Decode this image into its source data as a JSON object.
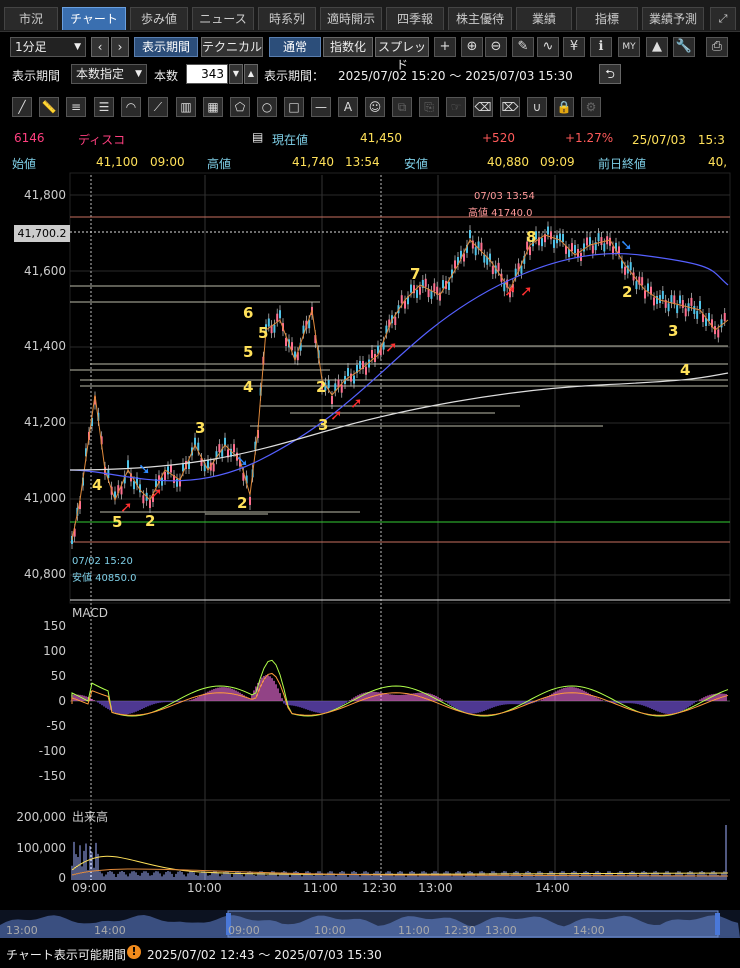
{
  "tabs": [
    "市況",
    "チャート",
    "歩み値",
    "ニュース",
    "時系列",
    "適時開示",
    "四季報",
    "株主優待",
    "業績",
    "指標",
    "業績予測"
  ],
  "active_tab": "チャート",
  "toolbar": {
    "interval": "1分足",
    "period_btn": "表示期間",
    "technical_btn": "テクニカル",
    "normal_btn": "通常",
    "index_btn": "指数化",
    "spread_btn": "スプレッド"
  },
  "period_bar": {
    "label": "表示期間",
    "mode": "本数指定",
    "count_label": "本数",
    "count": "343",
    "range_label": "表示期間：",
    "range": "2025/07/02 15:20 ～ 2025/07/03 15:30"
  },
  "quote": {
    "code": "6146",
    "name": "ディスコ",
    "current_label": "現在値",
    "current": "41,450",
    "change": "+520",
    "change_pct": "+1.27%",
    "datetime": "25/07/03　15:3",
    "open_label": "始値",
    "open": "41,100",
    "open_time": "09:00",
    "high_label": "高値",
    "high": "41,740",
    "high_time": "13:54",
    "low_label": "安値",
    "low": "40,880",
    "low_time": "09:09",
    "prev_label": "前日終値",
    "prev": "40,"
  },
  "price_axis": [
    "41,800",
    "41,700.2",
    "41,600",
    "41,400",
    "41,200",
    "41,000",
    "40,800"
  ],
  "annot": {
    "high_date": "07/03 13:54",
    "high_text": "高値 41740.0",
    "low_date": "07/02 15:20",
    "low_text": "安値 40850.0"
  },
  "macd": {
    "label": "MACD",
    "axis": [
      "150",
      "100",
      "50",
      "0",
      "-50",
      "-100",
      "-150"
    ]
  },
  "volume": {
    "label": "出来高",
    "axis": [
      "200,000",
      "100,000",
      "0"
    ]
  },
  "time_axis": [
    "09:00",
    "10:00",
    "11:00",
    "12:30",
    "13:00",
    "14:00"
  ],
  "nav_axis": [
    "13:00",
    "14:00",
    "09:00",
    "10:00",
    "11:00",
    "12:30",
    "13:00",
    "14:00"
  ],
  "footer": {
    "label": "チャート表示可能期間",
    "range": "2025/07/02 12:43 ～ 2025/07/03 15:30"
  },
  "wave_labels": [
    "4",
    "5",
    "2",
    "3",
    "2",
    "4",
    "5",
    "6",
    "5",
    "2",
    "3",
    "7",
    "8",
    "2",
    "3",
    "4"
  ],
  "colors": {
    "accent": "#3a6fb0",
    "up": "#ff5a5a",
    "label": "#ffe15a",
    "cyan": "#7fd0e8"
  }
}
